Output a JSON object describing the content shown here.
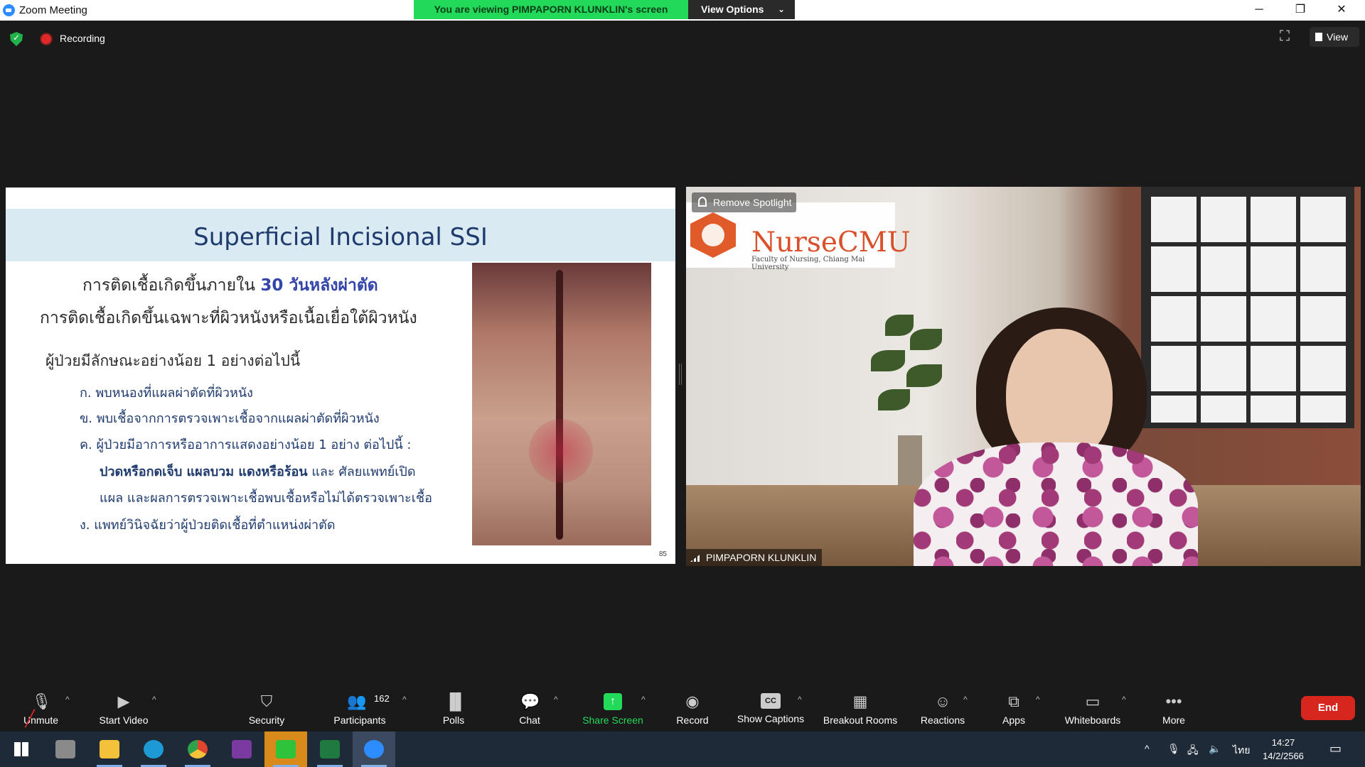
{
  "window": {
    "title": "Zoom Meeting",
    "viewing_banner": "You are viewing PIMPAPORN KLUNKLIN's screen",
    "view_options": "View Options",
    "controls": {
      "minimize": "─",
      "restore": "❐",
      "close": "✕"
    }
  },
  "status": {
    "recording": "Recording",
    "view": "View"
  },
  "slide": {
    "title": "Superficial Incisional SSI",
    "line1_prefix": "การติดเชื้อเกิดขึ้นภายใน ",
    "line1_highlight": "30 วันหลังผ่าตัด",
    "line2": "การติดเชื้อเกิดขึ้นเฉพาะที่ผิวหนังหรือเนื้อเยื่อใต้ผิวหนัง",
    "line3": "ผู้ป่วยมีลักษณะอย่างน้อย 1 อย่างต่อไปนี้",
    "items": {
      "a": "ก.  พบหนองที่แผลผ่าตัดที่ผิวหนัง",
      "b": "ข.  พบเชื้อจากการตรวจเพาะเชื้อจากแผลผ่าตัดที่ผิวหนัง",
      "c": "ค.  ผู้ป่วยมีอาการหรืออาการแสดงอย่างน้อย 1 อย่าง ต่อไปนี้ :",
      "c2_bold": "ปวดหรือกดเจ็บ แผลบวม แดงหรือร้อน",
      "c2_rest": " และ ศัลยแพทย์เปิด",
      "c3": "แผล และผลการตรวจเพาะเชื้อพบเชื้อหรือไม่ได้ตรวจเพาะเชื้อ",
      "d": "ง.  แพทย์วินิจฉัยว่าผู้ป่วยติดเชื้อที่ตำแหน่งผ่าตัด"
    },
    "page_number": "85"
  },
  "video": {
    "remove_spotlight": "Remove Spotlight",
    "logo_text": "NurseCMU",
    "logo_sub": "Faculty of Nursing, Chiang Mai University",
    "participant_name": "PIMPAPORN KLUNKLIN"
  },
  "toolbar": {
    "unmute": "Unmute",
    "start_video": "Start Video",
    "security": "Security",
    "participants": "Participants",
    "participant_count": "162",
    "polls": "Polls",
    "chat": "Chat",
    "share_screen": "Share Screen",
    "record": "Record",
    "show_captions": "Show Captions",
    "captions_icon": "CC",
    "breakout_rooms": "Breakout Rooms",
    "reactions": "Reactions",
    "apps": "Apps",
    "whiteboards": "Whiteboards",
    "more": "More",
    "end": "End",
    "accent_green": "#23d959",
    "end_red": "#d7261e"
  },
  "taskbar": {
    "language": "ไทย",
    "time": "14:27",
    "date": "14/2/2566"
  }
}
